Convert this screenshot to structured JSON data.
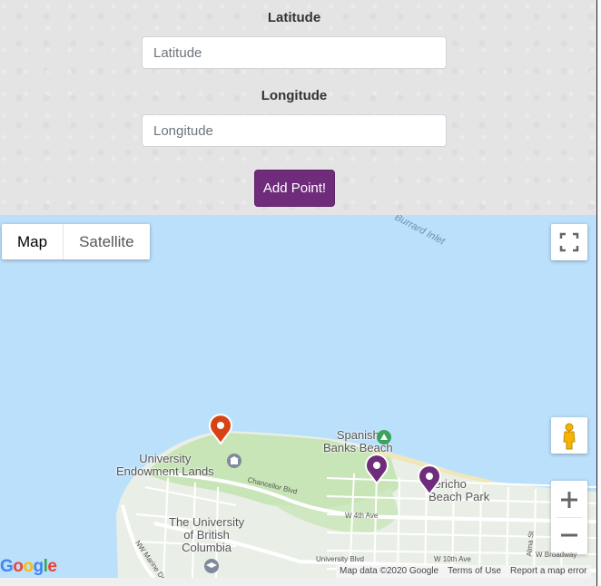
{
  "form": {
    "latitude_label": "Latitude",
    "latitude_placeholder": "Latitude",
    "latitude_value": "",
    "longitude_label": "Longitude",
    "longitude_placeholder": "Longitude",
    "longitude_value": "",
    "add_button_label": "Add Point!",
    "add_button_color": "#6f2c7a"
  },
  "map": {
    "map_type_options": [
      "Map",
      "Satellite"
    ],
    "selected_map_type": "Map",
    "water_label": "Burrard Inlet",
    "places": {
      "spanish_banks": "Spanish\nBanks Beach",
      "university_endowment": "University\nEndowment Lands",
      "jericho": "Jericho\nBeach Park",
      "ubc": "The University\nof British\nColumbia"
    },
    "road_labels": {
      "chancellor": "Chancellor Blvd",
      "w4th": "W 4th Ave",
      "w10th": "W 10th Ave",
      "university_blvd": "University Blvd",
      "w_broadway": "W Broadway",
      "nw_marine": "NW Marine Dr",
      "alma": "Alma St"
    },
    "markers": [
      {
        "color": "#d84315",
        "icon": "map-pin-icon"
      },
      {
        "color": "#6f2c7a",
        "icon": "map-pin-icon"
      },
      {
        "color": "#6f2c7a",
        "icon": "map-pin-icon"
      }
    ],
    "controls": {
      "fullscreen_icon": "fullscreen-icon",
      "pegman_icon": "pegman-icon",
      "zoom_in_symbol": "+",
      "zoom_out_symbol": "−"
    },
    "logo": "Google",
    "attribution": {
      "map_data": "Map data ©2020 Google",
      "terms": "Terms of Use",
      "report": "Report a map error"
    },
    "colors": {
      "water": "#bbe0fb",
      "land": "#e8eee4",
      "park": "#c9e6b8"
    }
  }
}
